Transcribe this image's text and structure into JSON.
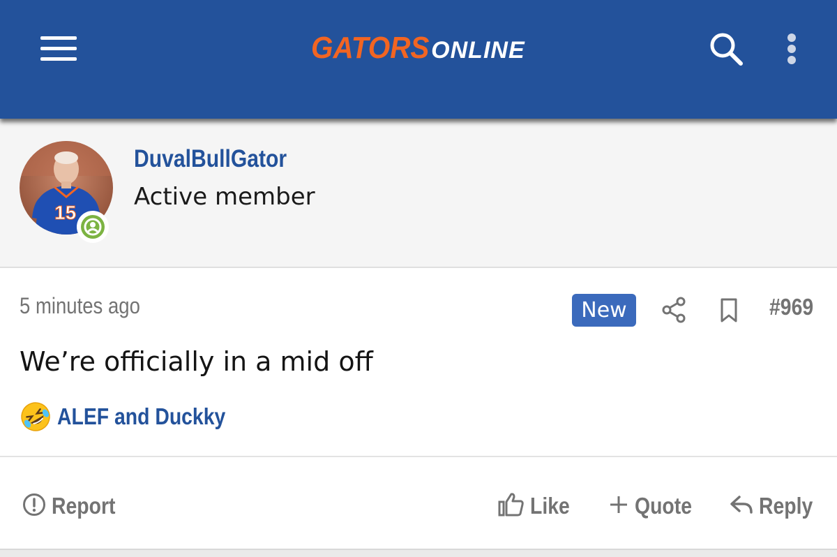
{
  "header": {
    "logo_part1": "GATORS",
    "logo_part2": "ONLINE",
    "bg_color": "#23529b",
    "logo_accent": "#f26522",
    "icons": [
      "menu-icon",
      "search-icon",
      "more-vertical-icon"
    ]
  },
  "user": {
    "name": "DuvalBullGator",
    "title": "Active member",
    "status_icon": "online-status-icon",
    "status_color": "#7cb342"
  },
  "post": {
    "time": "5 minutes ago",
    "badge": "New",
    "number": "#969",
    "body": "We’re officially in a mid off",
    "reaction_emoji": "rolling-on-floor-laughing-emoji",
    "reactors": "ALEF and Duckky"
  },
  "actions": {
    "report": "Report",
    "like": "Like",
    "quote": "Quote",
    "reply": "Reply"
  }
}
